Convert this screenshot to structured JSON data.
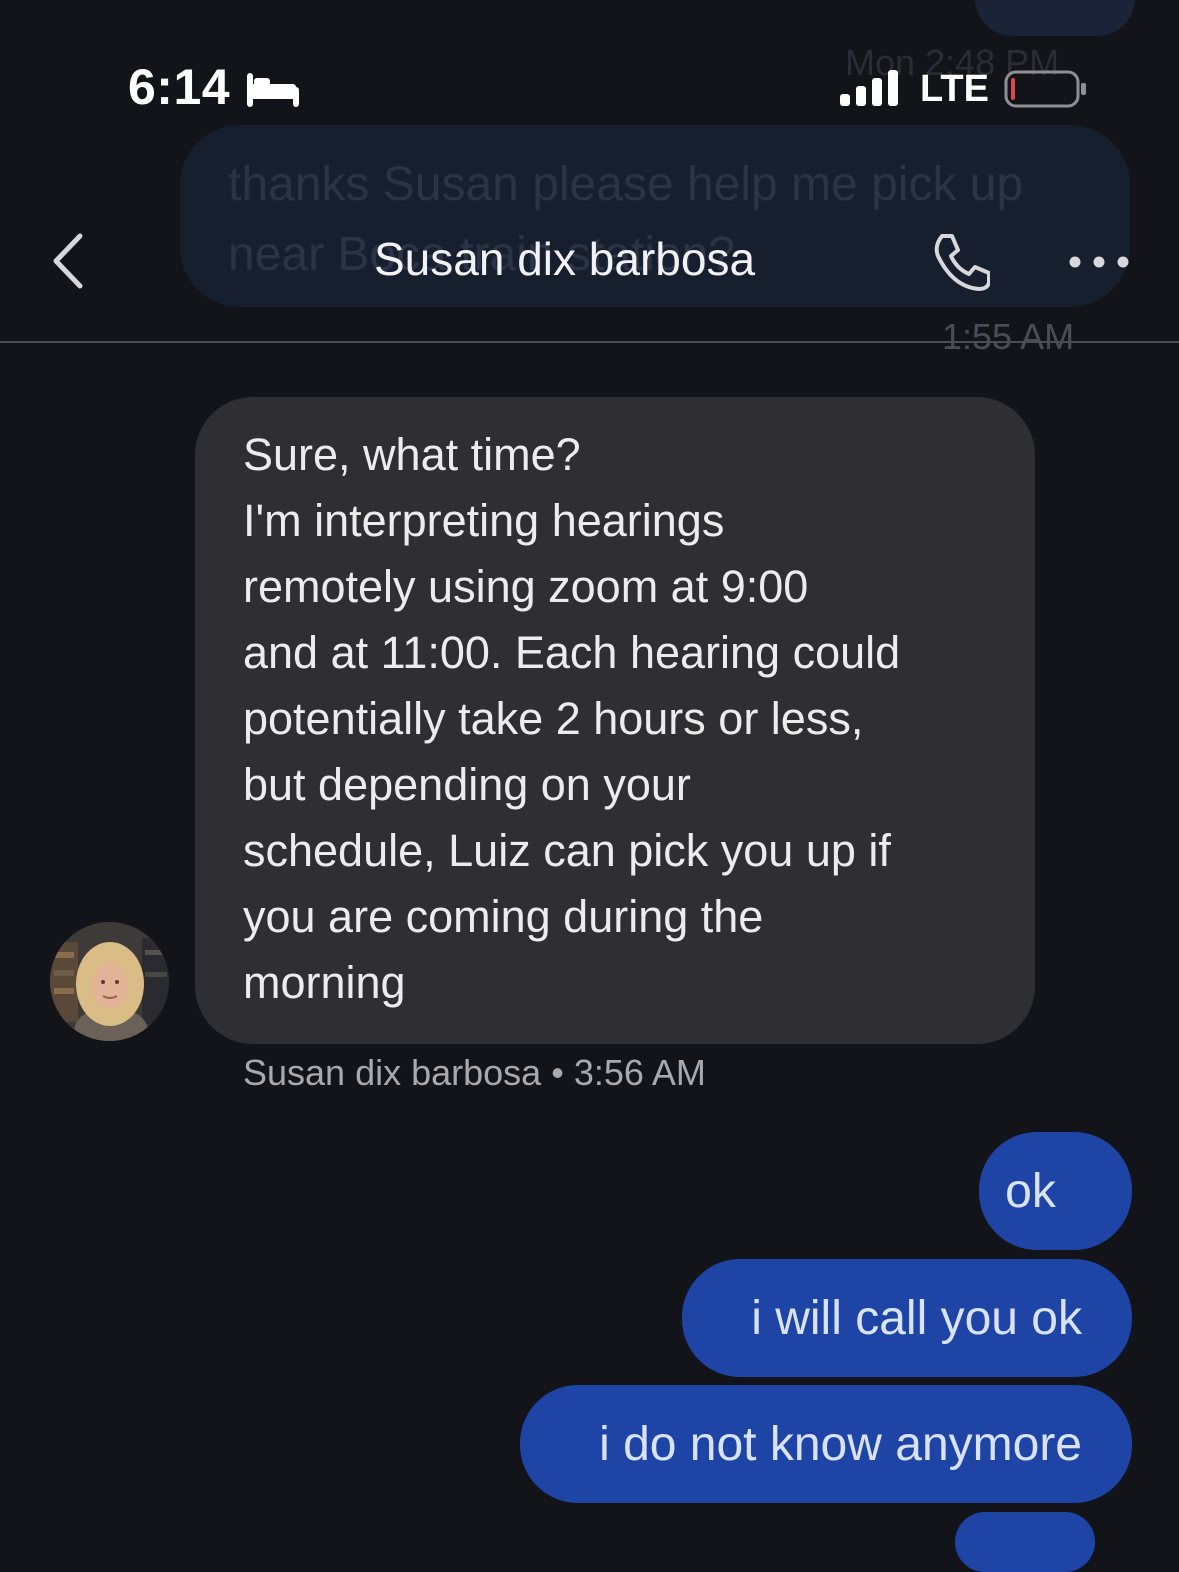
{
  "status_bar": {
    "time": "6:14",
    "network": "LTE"
  },
  "background_ghost": {
    "date_time": "Mon 2:48 PM",
    "message": "thanks Susan please help me pick up near Boca train station?",
    "time": "1:55 AM"
  },
  "header": {
    "title": "Susan dix barbosa"
  },
  "incoming_message": {
    "text": "Sure, what time?\nI'm interpreting hearings\nremotely using zoom at 9:00\nand at 11:00. Each hearing could\npotentially take 2 hours or less,\nbut depending on your\nschedule, Luiz can pick you up if\nyou are coming during the\nmorning",
    "sender": "Susan dix barbosa",
    "separator": "•",
    "timestamp": "3:56 AM"
  },
  "outgoing_messages": [
    {
      "text": "ok"
    },
    {
      "text": "i will call you ok"
    },
    {
      "text": "i do not know anymore"
    }
  ],
  "colors": {
    "background": "#131419",
    "incoming_bubble": "#2f2f33",
    "outgoing_bubble": "#1e45a6",
    "battery_low": "#e0434b"
  },
  "icons": [
    "bed-icon",
    "signal-icon",
    "battery-icon",
    "back-icon",
    "phone-icon",
    "more-icon"
  ]
}
